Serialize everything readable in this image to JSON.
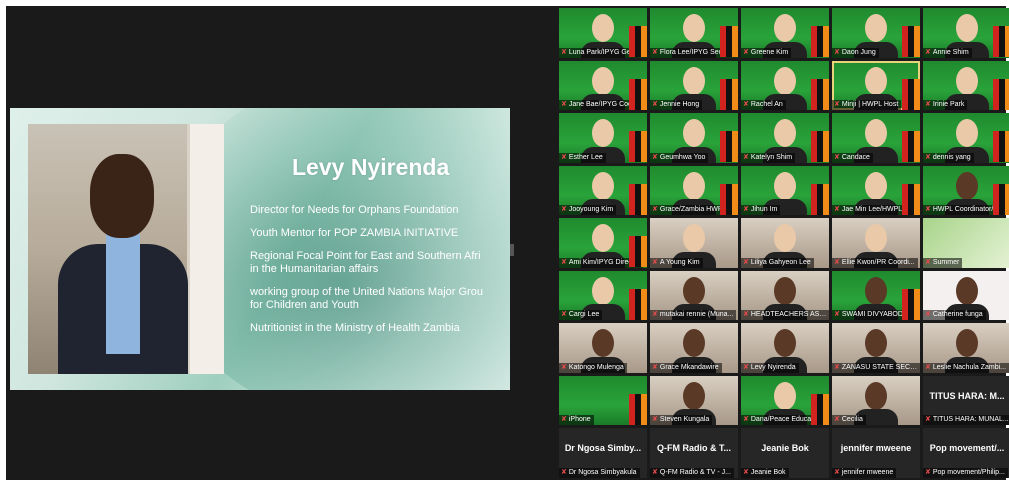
{
  "shared_slide": {
    "title": "Levy Nyirenda",
    "lines": [
      "Director for Needs for Orphans Foundation",
      "Youth Mentor for POP ZAMBIA INITIATIVE",
      "Regional Focal Point for East and Southern Afri\nin the Humanitarian affairs",
      "working group of the United Nations Major Grou\nfor Children and Youth",
      "Nutritionist in the Ministry of Health Zambia"
    ]
  },
  "gallery": {
    "tiles": [
      {
        "name": "Luna Park/IPYG Gener...",
        "style": "flag",
        "face": "light"
      },
      {
        "name": "Flora Lee/IPYG Secret...",
        "style": "flag",
        "face": "light"
      },
      {
        "name": "Greene Kim",
        "style": "flag",
        "face": "light"
      },
      {
        "name": "Daon Jung",
        "style": "flag",
        "face": "light"
      },
      {
        "name": "Annie Shim",
        "style": "flag",
        "face": "light"
      },
      {
        "name": "Jane Bae/IPYG Coordi...",
        "style": "flag",
        "face": "light"
      },
      {
        "name": "Jennie Hong",
        "style": "flag",
        "face": "light"
      },
      {
        "name": "Rachel An",
        "style": "flag",
        "face": "light"
      },
      {
        "name": "Minji | HWPL Host",
        "style": "flag",
        "face": "light",
        "active": true
      },
      {
        "name": "Irinie Park",
        "style": "flag",
        "face": "light"
      },
      {
        "name": "Esther Lee",
        "style": "flag",
        "face": "light"
      },
      {
        "name": "Geumhwa Yoo",
        "style": "flag",
        "face": "light"
      },
      {
        "name": "Katelyn Shim",
        "style": "flag",
        "face": "light"
      },
      {
        "name": "Candace",
        "style": "flag",
        "face": "light"
      },
      {
        "name": "dennis yang",
        "style": "flag",
        "face": "light"
      },
      {
        "name": "Jooyoung Kim",
        "style": "flag",
        "face": "light"
      },
      {
        "name": "Grace/Zambia HWPL",
        "style": "flag",
        "face": "light"
      },
      {
        "name": "Jihun Im",
        "style": "flag",
        "face": "light"
      },
      {
        "name": "Jae Min Lee/HWPL",
        "style": "flag",
        "face": "light"
      },
      {
        "name": "HWPL Coordinator/C...",
        "style": "flag",
        "face": "dark"
      },
      {
        "name": "Ami Kim/IPYG Director",
        "style": "flag",
        "face": "light"
      },
      {
        "name": "A Young Kim",
        "style": "room",
        "face": "light"
      },
      {
        "name": "Liliya Gahyeon Lee",
        "style": "room",
        "face": "light"
      },
      {
        "name": "Ellie Kwon/PR Coordi...",
        "style": "room",
        "face": "light"
      },
      {
        "name": "Summer",
        "style": "green2",
        "face": "none"
      },
      {
        "name": "Cargi Lee",
        "style": "flag",
        "face": "light"
      },
      {
        "name": "mutakai rennie (Muna...",
        "style": "room",
        "face": "dark"
      },
      {
        "name": "HEADTEACHERS ASS...",
        "style": "room",
        "face": "dark"
      },
      {
        "name": "SWAMI DIVYABODHA...",
        "style": "flag",
        "face": "dark"
      },
      {
        "name": "Catherine funga",
        "style": "pink",
        "face": "dark"
      },
      {
        "name": "Katongo Mulenga",
        "style": "room",
        "face": "dark"
      },
      {
        "name": "Grace Mkandawire",
        "style": "room",
        "face": "dark"
      },
      {
        "name": "Levy Nyirenda",
        "style": "room",
        "face": "dark"
      },
      {
        "name": "ZANASU STATE SECR...",
        "style": "room",
        "face": "dark"
      },
      {
        "name": "Leslie Nachula Zambi...",
        "style": "room",
        "face": "dark"
      },
      {
        "name": "iPhone",
        "style": "flag",
        "face": "none"
      },
      {
        "name": "Steven Kungala",
        "style": "room",
        "face": "dark"
      },
      {
        "name": "Dana/Peace Education",
        "style": "flag",
        "face": "light"
      },
      {
        "name": "Cecilia",
        "style": "room",
        "face": "dark"
      },
      {
        "name": "TITUS HARA: MUNAL...",
        "style": "black",
        "face": "none",
        "big": "TITUS HARA: M..."
      },
      {
        "name": "Dr Ngosa Simbyakula",
        "style": "black",
        "face": "none",
        "big": "Dr Ngosa Simby..."
      },
      {
        "name": "Q-FM Radio & TV - J...",
        "style": "black",
        "face": "none",
        "big": "Q-FM Radio & T..."
      },
      {
        "name": "Jeanie Bok",
        "style": "black",
        "face": "none",
        "big": "Jeanie Bok"
      },
      {
        "name": "jennifer mweene",
        "style": "black",
        "face": "none",
        "big": "jennifer mweene"
      },
      {
        "name": "Pop movement/Philip...",
        "style": "black",
        "face": "none",
        "big": "Pop movement/..."
      }
    ]
  },
  "icons": {
    "muted_mic": "muted-mic-icon"
  }
}
